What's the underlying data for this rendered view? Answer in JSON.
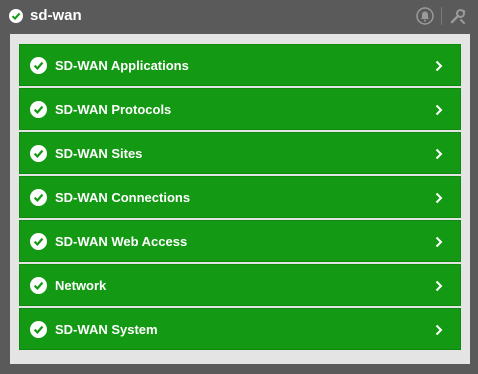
{
  "header": {
    "title": "sd-wan",
    "icons": [
      "alert-bell-icon",
      "tools-icon"
    ]
  },
  "colors": {
    "item_bg": "#149914",
    "panel_bg": "#5a5a5a",
    "content_bg": "#e4e4e4"
  },
  "items": [
    {
      "label": "SD-WAN Applications"
    },
    {
      "label": "SD-WAN Protocols"
    },
    {
      "label": "SD-WAN Sites"
    },
    {
      "label": "SD-WAN Connections"
    },
    {
      "label": "SD-WAN Web Access"
    },
    {
      "label": "Network"
    },
    {
      "label": "SD-WAN System"
    }
  ]
}
